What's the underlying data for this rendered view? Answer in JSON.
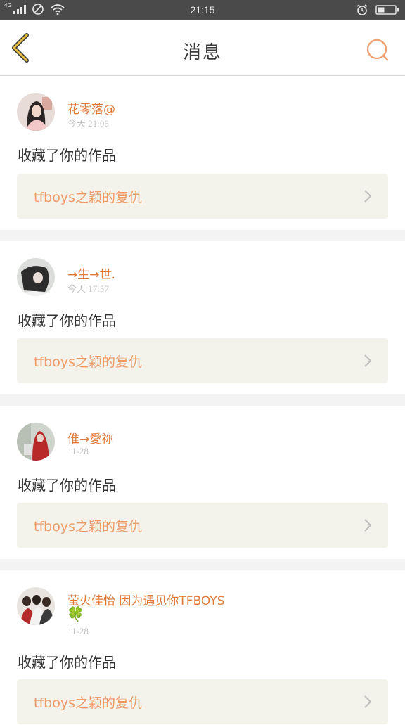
{
  "status_bar": {
    "network_label": "4G",
    "time": "21:15",
    "icons": [
      "signal-icon",
      "no-entry-icon",
      "wifi-icon",
      "alarm-icon",
      "battery-icon"
    ]
  },
  "header": {
    "title": "消息",
    "back_icon": "chevron-left-icon",
    "search_icon": "search-icon",
    "accent_color": "#f0a070",
    "back_icon_color": "#e8c040"
  },
  "notifications": [
    {
      "username": "花零落@",
      "extra": "",
      "time": "今天 21:06",
      "action": "收藏了你的作品",
      "work_title": "tfboys之颖的复仇"
    },
    {
      "username": "→生→世.",
      "extra": "",
      "time": "今天 17:57",
      "action": "收藏了你的作品",
      "work_title": "tfboys之颖的复仇"
    },
    {
      "username": "倠→愛祢",
      "extra": "",
      "time": "11-28",
      "action": "收藏了你的作品",
      "work_title": "tfboys之颖的复仇"
    },
    {
      "username": "萤火佳怡   因为遇见你TFBOYS",
      "extra": "🍀",
      "time": "11-28",
      "action": "收藏了你的作品",
      "work_title": "tfboys之颖的复仇"
    }
  ],
  "colors": {
    "username": "#e07a3a",
    "work_title": "#ee9a66",
    "work_bg": "#f3f3ec",
    "statusbar_bg": "#4a4a4a"
  }
}
